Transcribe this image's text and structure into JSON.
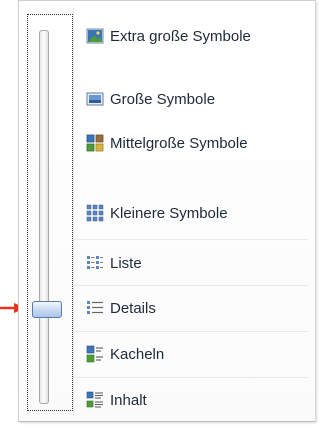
{
  "menu": {
    "items": [
      {
        "label": "Extra große Symbole",
        "icon": "extra-large-icons-icon"
      },
      {
        "label": "Große Symbole",
        "icon": "large-icons-icon"
      },
      {
        "label": "Mittelgroße Symbole",
        "icon": "medium-icons-icon"
      },
      {
        "label": "Kleinere Symbole",
        "icon": "small-icons-icon"
      },
      {
        "label": "Liste",
        "icon": "list-icon"
      },
      {
        "label": "Details",
        "icon": "details-icon"
      },
      {
        "label": "Kacheln",
        "icon": "tiles-icon"
      },
      {
        "label": "Inhalt",
        "icon": "content-icon"
      }
    ]
  },
  "slider": {
    "selected": "Details",
    "pointer_color": "#e8341c"
  }
}
